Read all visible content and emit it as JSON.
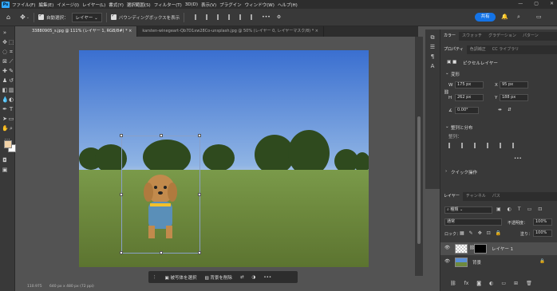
{
  "menubar": {
    "logo": "Ps",
    "items": [
      "ファイル(F)",
      "編集(E)",
      "イメージ(I)",
      "レイヤー(L)",
      "書式(Y)",
      "選択範囲(S)",
      "フィルター(T)",
      "3D(D)",
      "表示(V)",
      "プラグイン",
      "ウィンドウ(W)",
      "ヘルプ(H)"
    ],
    "window_controls": [
      "—",
      "▢",
      "✕"
    ]
  },
  "options": {
    "home_icon": "home-icon",
    "auto_select_label": "自動選択：",
    "auto_select_value": "レイヤー",
    "bounding_box_label": "バウンディングボックスを表示",
    "share_label": "共有"
  },
  "doc_tabs": [
    {
      "label": "33880905_s.jpg @ 111% (レイヤー 1, RGB/8#) *",
      "close": "×"
    },
    {
      "label": "karsten-winegeart-Qb7D1xw28Co-unsplash.jpg @ 50% (レイヤー 0, レイヤーマスク/8) *",
      "close": "×"
    }
  ],
  "context_bar": {
    "select_subject": "被写体を選択",
    "remove_bg": "背景を削除",
    "more": "•••"
  },
  "status": {
    "zoom": "110.975",
    "dims": "640 px x 480 px (72 ppi)"
  },
  "panel_top": {
    "tabs": [
      "カラー",
      "スウォッチ",
      "グラデーション",
      "パターン"
    ],
    "tabs2": [
      "プロパティ",
      "色調補正",
      "CC ライブラリ"
    ],
    "layer_type": "ピクセルレイヤー",
    "transform_header": "変形",
    "w_label": "W",
    "w_value": "175 px",
    "x_label": "X",
    "x_value": "95 px",
    "h_label": "H",
    "h_value": "262 px",
    "y_label": "Y",
    "y_value": "188 px",
    "angle": "0.00°",
    "align_header": "整列と分布",
    "align_sub": "整列：",
    "quick_header": "クイック操作",
    "more": "•••"
  },
  "layers_panel": {
    "tabs": [
      "レイヤー",
      "チャンネル",
      "パス"
    ],
    "search": "種類",
    "blend_mode": "通常",
    "opacity_label": "不透明度：",
    "opacity_value": "100%",
    "lock_label": "ロック：",
    "fill_label": "塗り：",
    "fill_value": "100%",
    "layers": [
      {
        "name": "レイヤー 1",
        "selected": true
      },
      {
        "name": "背景",
        "selected": false
      }
    ]
  }
}
